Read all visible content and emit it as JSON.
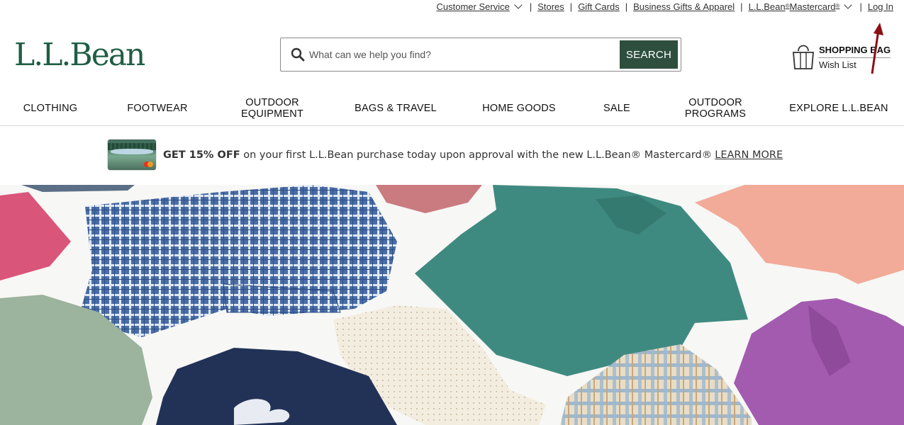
{
  "utility": {
    "customer_service": "Customer Service",
    "stores": "Stores",
    "gift_cards": "Gift Cards",
    "business_gifts": "Business Gifts & Apparel",
    "mastercard": "L.L.Bean",
    "mastercard_reg": "®",
    "mastercard_rest": " Mastercard",
    "mastercard_reg2": "®",
    "login": "Log In",
    "separator": "|"
  },
  "brand": {
    "logo": "L.L.Bean",
    "color": "#1f5e43"
  },
  "search": {
    "placeholder": "What can we help you find?",
    "button_label": "SEARCH",
    "icon": "search-icon",
    "button_color": "#2e4f3e"
  },
  "bag": {
    "label": "SHOPPING BAG",
    "wish_list": "Wish List",
    "icon": "shopping-bag-icon"
  },
  "nav": {
    "items": [
      {
        "label": "CLOTHING"
      },
      {
        "label": "FOOTWEAR"
      },
      {
        "label_line1": "OUTDOOR",
        "label_line2": "EQUIPMENT"
      },
      {
        "label": "BAGS & TRAVEL"
      },
      {
        "label": "HOME GOODS"
      },
      {
        "label": "SALE"
      },
      {
        "label_line1": "OUTDOOR",
        "label_line2": "PROGRAMS"
      },
      {
        "label": "EXPLORE L.L.BEAN"
      }
    ]
  },
  "promo": {
    "bold": "GET 15% OFF",
    "text": " on your first L.L.Bean purchase today upon approval with the new L.L.Bean® Mastercard®",
    "link": "LEARN MORE"
  },
  "annotation": {
    "arrow_color": "#8b0f14"
  }
}
